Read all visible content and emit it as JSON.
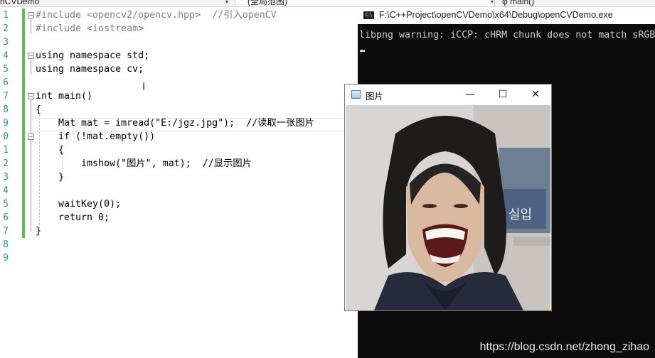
{
  "topbar": {
    "project": "nCVDemo",
    "scope": "(全局范围)",
    "function": "main()"
  },
  "editor": {
    "line_numbers": [
      "1",
      "2",
      "3",
      "4",
      "5",
      "6",
      "7",
      "8",
      "9",
      "0",
      "1",
      "2",
      "3",
      "4",
      "5",
      "6",
      "7",
      "8",
      "9"
    ],
    "lines": [
      "#include <opencv2/opencv.hpp>  //引入openCV",
      "#include <iostream>",
      "",
      "using namespace std;",
      "using namespace cv;",
      "",
      "int main()",
      "{",
      "    Mat mat = imread(\"E:/jgz.jpg\");  //读取一张图片",
      "    if (!mat.empty())",
      "    {",
      "        imshow(\"图片\", mat);  //显示图片",
      "    }",
      "",
      "    waitKey(0);",
      "    return 0;",
      "}",
      "",
      ""
    ]
  },
  "console": {
    "title": "F:\\C++Project\\openCVDemo\\x64\\Debug\\openCVDemo.exe",
    "icon_text": "C:\\",
    "output": "libpng warning: iCCP: cHRM chunk does not match sRGB"
  },
  "image_window": {
    "title": "图片",
    "minimize": "—",
    "maximize": "☐",
    "close": "✕"
  },
  "watermark": "https://blog.csdn.net/zhong_zihao",
  "colors": {
    "keyword": "#0000ff",
    "preprocessor": "#808080",
    "string": "#a31515",
    "comment": "#008000",
    "type": "#2b91af",
    "console_bg": "#0c0c0c",
    "console_fg": "#cccccc",
    "changed_bar": "#57c24f"
  }
}
